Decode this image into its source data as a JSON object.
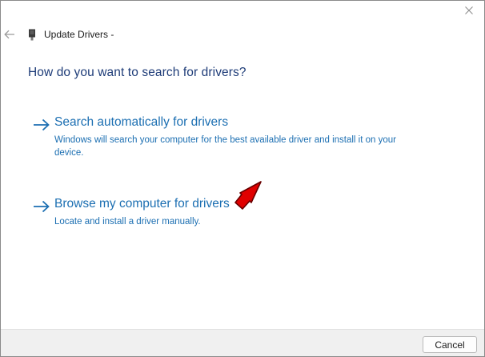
{
  "window": {
    "title": "Update Drivers -"
  },
  "heading": "How do you want to search for drivers?",
  "options": [
    {
      "label": "Search automatically for drivers",
      "description": "Windows will search your computer for the best available driver and install it on your device."
    },
    {
      "label": "Browse my computer for drivers",
      "description": "Locate and install a driver manually."
    }
  ],
  "footer": {
    "cancel_label": "Cancel"
  },
  "icons": {
    "back": "back-arrow-icon",
    "close": "close-icon",
    "device": "device-icon",
    "option_arrow": "right-arrow-icon",
    "annotation": "red-pointer-arrow"
  },
  "colors": {
    "heading": "#1e3c78",
    "link": "#1c6fb2",
    "annotation": "#e00000",
    "footer_bg": "#f0f0f0"
  }
}
